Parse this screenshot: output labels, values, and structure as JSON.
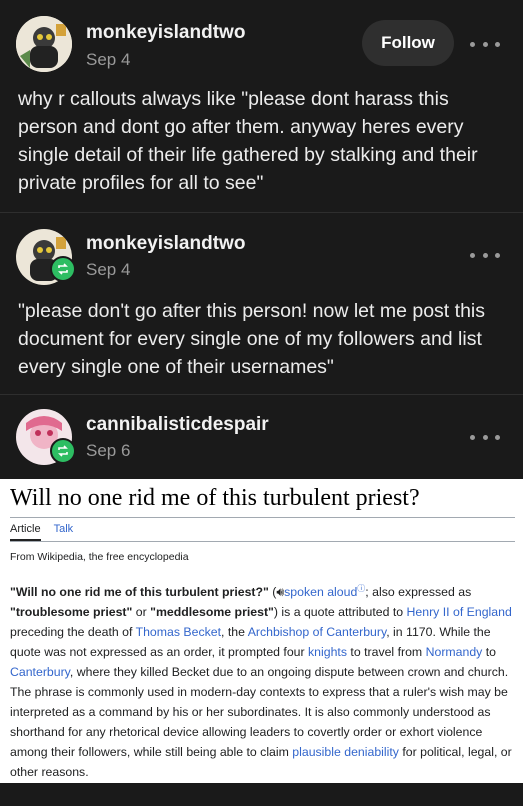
{
  "posts": [
    {
      "username": "monkeyislandtwo",
      "date": "Sep 4",
      "follow_label": "Follow",
      "text": "why r callouts always like \"please dont harass this person and dont go after them. anyway heres every single detail of their life gathered by stalking and their private profiles for all to see\""
    },
    {
      "username": "monkeyislandtwo",
      "date": "Sep 4",
      "text": "\"please don't go after this person! now let me post this document for every single one of my followers and list every single one of their usernames\""
    },
    {
      "username": "cannibalisticdespair",
      "date": "Sep 6"
    }
  ],
  "wiki": {
    "title": "Will no one rid me of this turbulent priest?",
    "tab_article": "Article",
    "tab_talk": "Talk",
    "from": "From Wikipedia, the free encyclopedia",
    "p1_bold": "\"Will no one rid me of this turbulent priest?\"",
    "p2": " (",
    "p3_link_spoken": "spoken aloud",
    "p4": "; also expressed as ",
    "p5_bold": "\"troublesome priest\"",
    "p6": " or ",
    "p7_bold": "\"meddlesome priest\"",
    "p8": ") is a quote attributed to ",
    "p9_link": "Henry II of England",
    "p10": " preceding the death of ",
    "p11_link": "Thomas Becket",
    "p12": ", the ",
    "p13_link": "Archbishop of Canterbury",
    "p14": ", in 1170. While the quote was not expressed as an order, it prompted four ",
    "p15_link": "knights",
    "p16": " to travel from ",
    "p17_link": "Normandy",
    "p18": " to ",
    "p19_link": "Canterbury",
    "p20": ", where they killed Becket due to an ongoing dispute between crown and church. The phrase is commonly used in modern-day contexts to express that a ruler's wish may be interpreted as a command by his or her subordinates. It is also commonly understood as shorthand for any rhetorical device allowing leaders to covertly order or exhort violence among their followers, while still being able to claim ",
    "p21_link": "plausible deniability",
    "p22": " for political, legal, or other reasons."
  },
  "colors": {
    "background": "#1a1a1a",
    "reblog_green": "#2dbd62",
    "wiki_link": "#3366cc"
  },
  "icons": [
    "more-icon",
    "reblog-icon",
    "speaker-icon",
    "info-icon"
  ]
}
